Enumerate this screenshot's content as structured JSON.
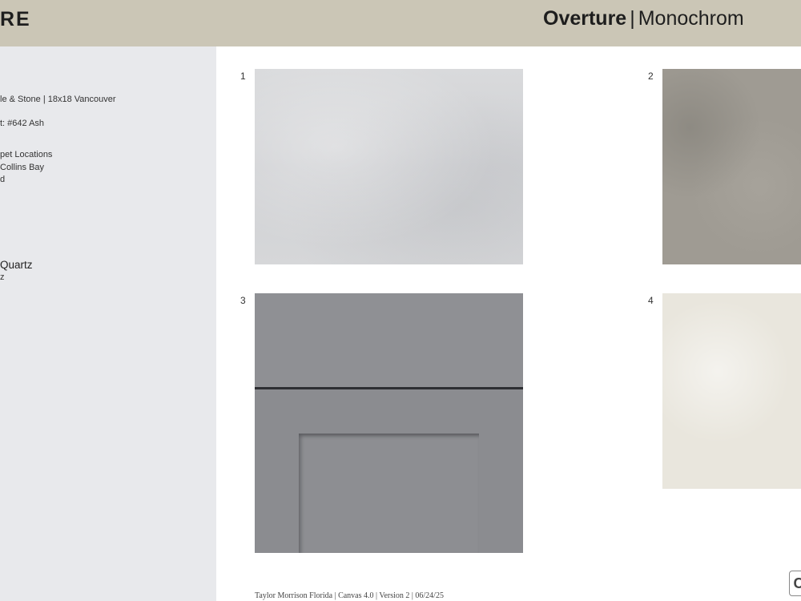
{
  "header": {
    "brand_fragment": "RE",
    "collection": "Overture",
    "separator": "|",
    "scheme": "Monochrom"
  },
  "sidebar": {
    "lines": [
      "le & Stone | 18x18 Vancouver",
      "t: #642 Ash",
      "pet Locations",
      "Collins Bay",
      "d",
      "Quartz",
      "z"
    ]
  },
  "swatches": [
    {
      "number": "1",
      "material": "light gray tile"
    },
    {
      "number": "2",
      "material": "gray carpet"
    },
    {
      "number": "3",
      "material": "gray shaker cabinet door"
    },
    {
      "number": "4",
      "material": "white quartz"
    }
  ],
  "footer": {
    "text": "Taylor Morrison Florida | Canvas 4.0 | Version 2 | 06/24/25"
  },
  "corner_logo": {
    "letter": "C"
  }
}
